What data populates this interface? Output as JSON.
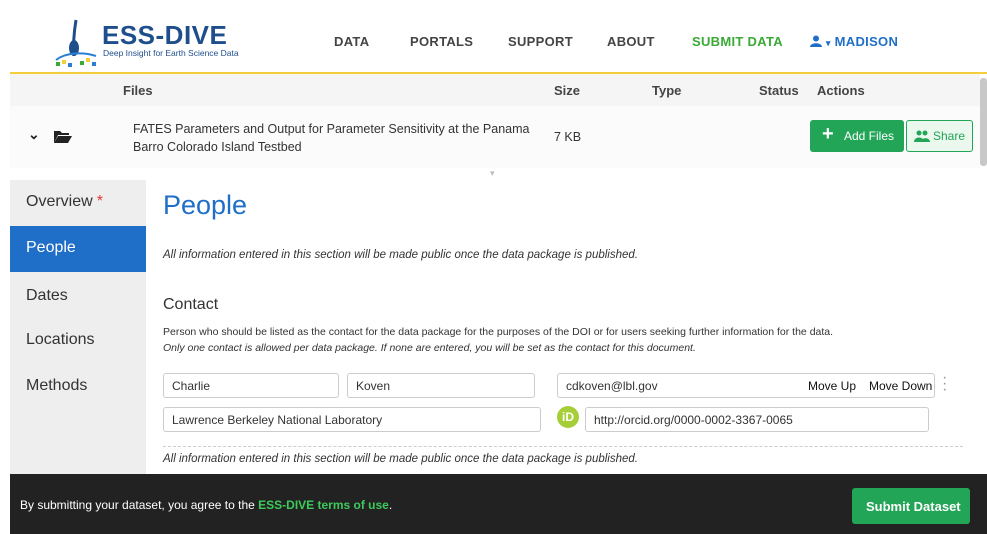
{
  "header": {
    "logo_text": "ESS-DIVE",
    "logo_tagline": "Deep Insight for Earth Science Data",
    "nav": [
      "DATA",
      "PORTALS",
      "SUPPORT",
      "ABOUT",
      "SUBMIT DATA"
    ],
    "user_label": "MADISON",
    "accent_yellow": "#f2cf3b",
    "brand_blue": "#1f4e8d"
  },
  "files": {
    "columns": [
      "Files",
      "Size",
      "Type",
      "Status",
      "Actions"
    ],
    "row": {
      "name": "FATES Parameters and Output for Parameter Sensitivity at the Panama Barro Colorado Island Testbed",
      "size": "7 KB"
    },
    "add_files_label": "Add Files",
    "share_label": "Share"
  },
  "sidebar": {
    "items": [
      {
        "label": "Overview",
        "required": "*"
      },
      {
        "label": "People"
      },
      {
        "label": "Dates"
      },
      {
        "label": "Locations"
      },
      {
        "label": "Methods"
      }
    ],
    "active": "People",
    "active_color": "#1f6ec7"
  },
  "main": {
    "title": "People",
    "public_note": "All information entered in this section will be made public once the data package is published.",
    "contact": {
      "title": "Contact",
      "description": "Person who should be listed as the contact for the data package for the purposes of the DOI or for users seeking further information for the data.",
      "note": "Only one contact is allowed per data package. If none are entered, you will be set as the contact for this document.",
      "first_name": "Charlie",
      "last_name": "Koven",
      "email": "cdkoven@lbl.gov",
      "move_up": "Move Up",
      "move_down": "Move Down",
      "organization": "Lawrence Berkeley National Laboratory",
      "orcid_badge": "iD",
      "orcid": "http://orcid.org/0000-0002-3367-0065"
    }
  },
  "footer": {
    "text_prefix": "By submitting your dataset, you agree to the ",
    "link_text": "ESS-DIVE terms of use",
    "text_suffix": ".",
    "submit_label": "Submit Dataset"
  }
}
